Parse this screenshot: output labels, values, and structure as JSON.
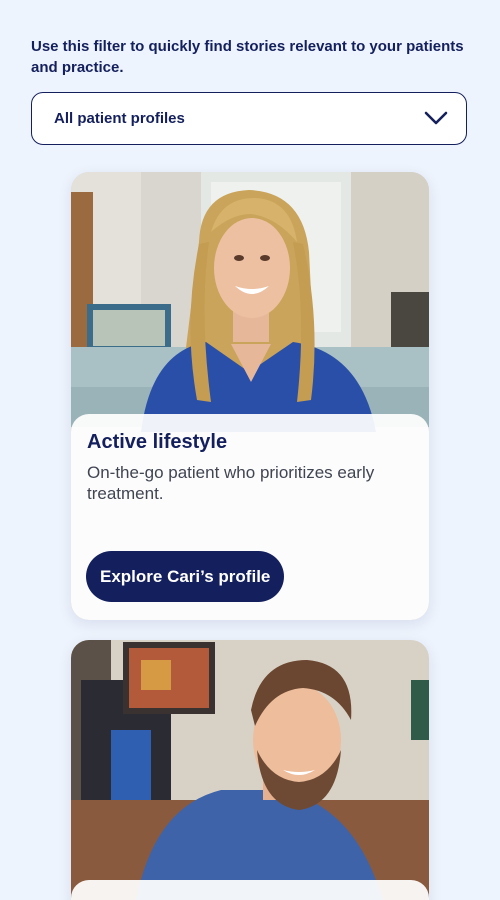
{
  "filter_section": {
    "intro_text": "Use this filter to quickly find stories relevant to your patients and practice.",
    "dropdown_selected": "All patient profiles",
    "dropdown_icon": "chevron-down-icon"
  },
  "profiles": [
    {
      "title": "Active lifestyle",
      "description": "On-the-go patient who prioritizes early treatment.",
      "button_label": "Explore Cari’s profile"
    }
  ],
  "colors": {
    "page_background": "#eef4fd",
    "brand_navy": "#14205e",
    "card_panel": "#ffffff",
    "body_text": "#404552"
  }
}
